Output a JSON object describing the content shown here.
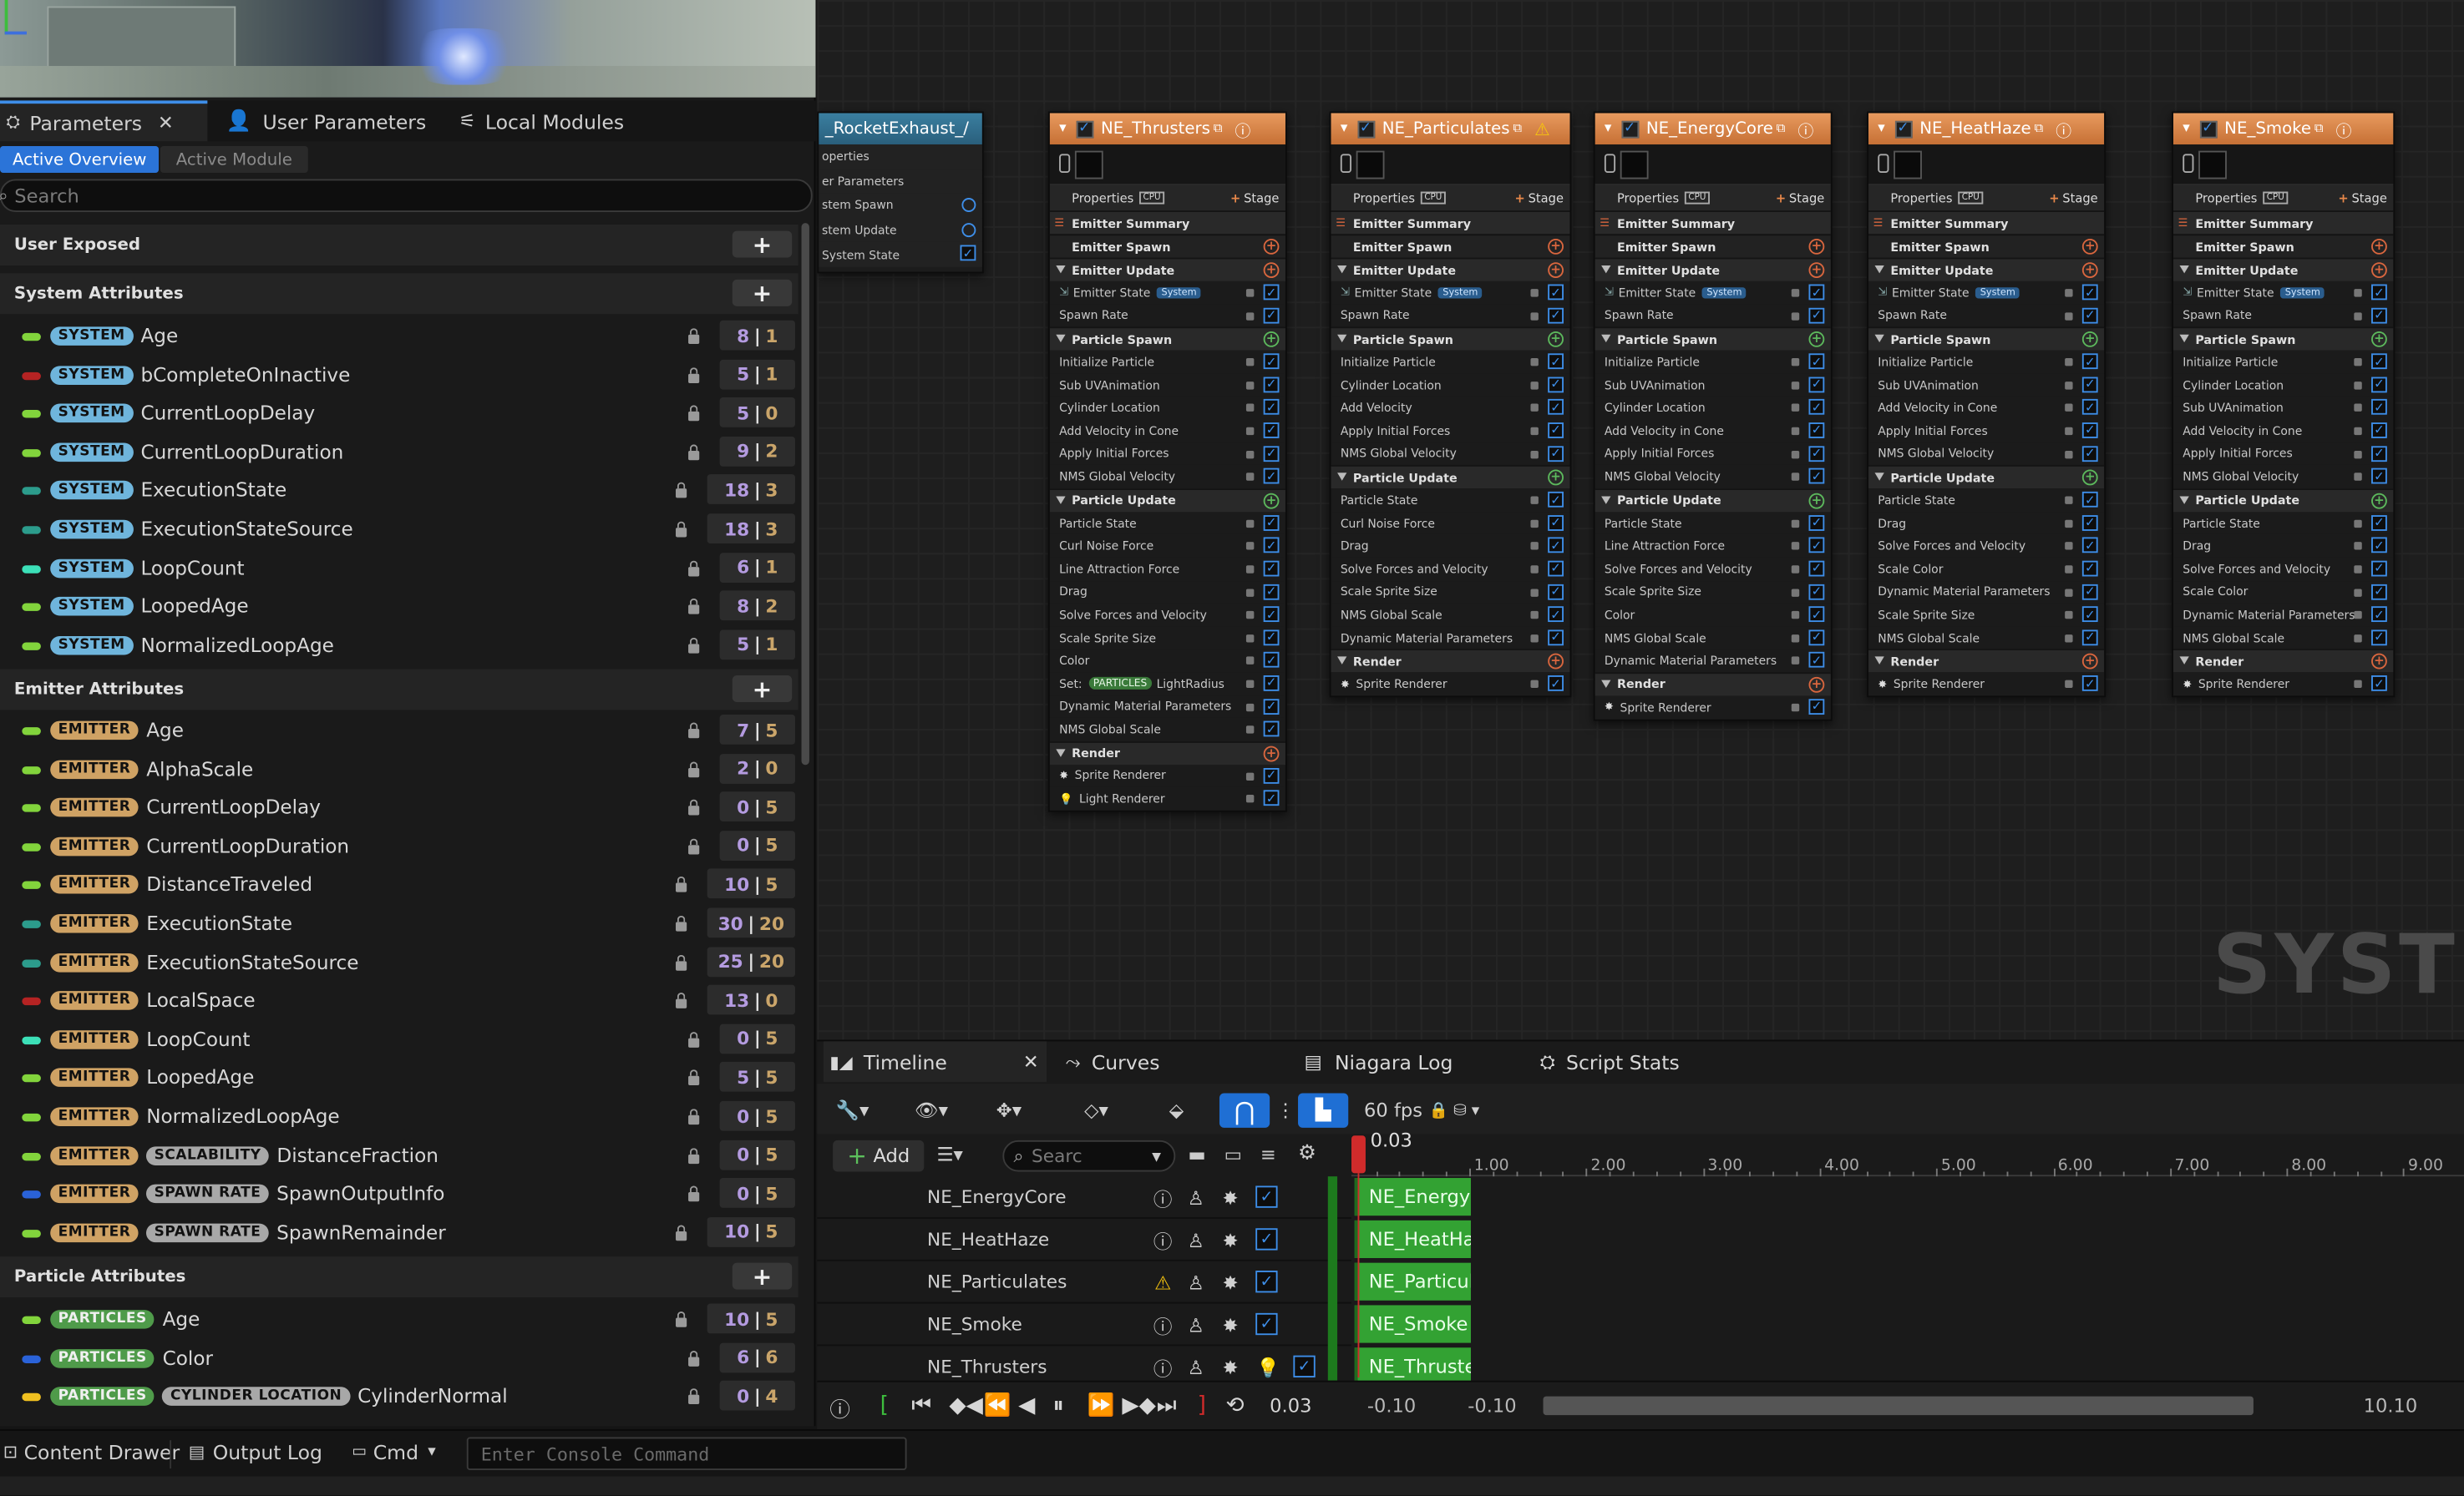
{
  "left_tabs": [
    {
      "label": "Parameters",
      "active": true
    },
    {
      "label": "User Parameters"
    },
    {
      "label": "Local Modules"
    }
  ],
  "sub_tabs": {
    "active": "Active Overview",
    "inactive": "Active Module"
  },
  "search_placeholder": "Search",
  "sections": {
    "user": "User Exposed",
    "system": "System Attributes",
    "emitter": "Emitter Attributes",
    "particle": "Particle Attributes"
  },
  "system_attrs": [
    {
      "badge": "SYSTEM",
      "name": "Age",
      "a": "8",
      "b": "1",
      "color": "#82d43c"
    },
    {
      "badge": "SYSTEM",
      "name": "bCompleteOnInactive",
      "a": "5",
      "b": "1",
      "color": "#b52323"
    },
    {
      "badge": "SYSTEM",
      "name": "CurrentLoopDelay",
      "a": "5",
      "b": "0",
      "color": "#82d43c"
    },
    {
      "badge": "SYSTEM",
      "name": "CurrentLoopDuration",
      "a": "9",
      "b": "2",
      "color": "#82d43c"
    },
    {
      "badge": "SYSTEM",
      "name": "ExecutionState",
      "a": "18",
      "b": "3",
      "color": "#2c9c8c"
    },
    {
      "badge": "SYSTEM",
      "name": "ExecutionStateSource",
      "a": "18",
      "b": "3",
      "color": "#2c9c8c"
    },
    {
      "badge": "SYSTEM",
      "name": "LoopCount",
      "a": "6",
      "b": "1",
      "color": "#3ce0b8"
    },
    {
      "badge": "SYSTEM",
      "name": "LoopedAge",
      "a": "8",
      "b": "2",
      "color": "#82d43c"
    },
    {
      "badge": "SYSTEM",
      "name": "NormalizedLoopAge",
      "a": "5",
      "b": "1",
      "color": "#82d43c"
    }
  ],
  "emitter_attrs": [
    {
      "badges": [
        "EMITTER"
      ],
      "name": "Age",
      "a": "7",
      "b": "5",
      "color": "#82d43c"
    },
    {
      "badges": [
        "EMITTER"
      ],
      "name": "AlphaScale",
      "a": "2",
      "b": "0",
      "color": "#82d43c"
    },
    {
      "badges": [
        "EMITTER"
      ],
      "name": "CurrentLoopDelay",
      "a": "0",
      "b": "5",
      "color": "#82d43c"
    },
    {
      "badges": [
        "EMITTER"
      ],
      "name": "CurrentLoopDuration",
      "a": "0",
      "b": "5",
      "color": "#82d43c"
    },
    {
      "badges": [
        "EMITTER"
      ],
      "name": "DistanceTraveled",
      "a": "10",
      "b": "5",
      "color": "#82d43c"
    },
    {
      "badges": [
        "EMITTER"
      ],
      "name": "ExecutionState",
      "a": "30",
      "b": "20",
      "color": "#2c9c8c"
    },
    {
      "badges": [
        "EMITTER"
      ],
      "name": "ExecutionStateSource",
      "a": "25",
      "b": "20",
      "color": "#2c9c8c"
    },
    {
      "badges": [
        "EMITTER"
      ],
      "name": "LocalSpace",
      "a": "13",
      "b": "0",
      "color": "#b52323"
    },
    {
      "badges": [
        "EMITTER"
      ],
      "name": "LoopCount",
      "a": "0",
      "b": "5",
      "color": "#3ce0b8"
    },
    {
      "badges": [
        "EMITTER"
      ],
      "name": "LoopedAge",
      "a": "5",
      "b": "5",
      "color": "#82d43c"
    },
    {
      "badges": [
        "EMITTER"
      ],
      "name": "NormalizedLoopAge",
      "a": "0",
      "b": "5",
      "color": "#82d43c"
    },
    {
      "badges": [
        "EMITTER",
        "SCALABILITY"
      ],
      "name": "DistanceFraction",
      "a": "0",
      "b": "5",
      "color": "#82d43c"
    },
    {
      "badges": [
        "EMITTER",
        "SPAWN RATE"
      ],
      "name": "SpawnOutputInfo",
      "a": "0",
      "b": "5",
      "color": "#2a62d8"
    },
    {
      "badges": [
        "EMITTER",
        "SPAWN RATE"
      ],
      "name": "SpawnRemainder",
      "a": "10",
      "b": "5",
      "color": "#82d43c"
    }
  ],
  "particle_attrs": [
    {
      "badges": [
        "PARTICLES"
      ],
      "name": "Age",
      "a": "10",
      "b": "5",
      "color": "#82d43c"
    },
    {
      "badges": [
        "PARTICLES"
      ],
      "name": "Color",
      "a": "6",
      "b": "6",
      "color": "#2a62d8"
    },
    {
      "badges": [
        "PARTICLES",
        "CYLINDER LOCATION"
      ],
      "name": "CylinderNormal",
      "a": "0",
      "b": "4",
      "color": "#f0c020"
    }
  ],
  "system_node": {
    "title": "_RocketExhaust_/",
    "rows": [
      "operties",
      "er Parameters",
      "stem Spawn",
      "stem Update",
      "System State"
    ]
  },
  "emitters": [
    {
      "title": "NE_Thrusters",
      "warn": false,
      "sections": [
        {
          "t": "Emitter Summary",
          "k": "sum"
        },
        {
          "t": "Emitter Spawn",
          "k": "sec"
        },
        {
          "t": "Emitter Update",
          "k": "sec"
        },
        {
          "t": "Emitter State",
          "k": "mod",
          "chip": "System"
        },
        {
          "t": "Spawn Rate",
          "k": "mod"
        },
        {
          "t": "Particle Spawn",
          "k": "sec",
          "g": true
        },
        {
          "t": "Initialize Particle",
          "k": "mod"
        },
        {
          "t": "Sub UVAnimation",
          "k": "mod"
        },
        {
          "t": "Cylinder Location",
          "k": "mod"
        },
        {
          "t": "Add Velocity in Cone",
          "k": "mod"
        },
        {
          "t": "Apply Initial Forces",
          "k": "mod"
        },
        {
          "t": "NMS Global Velocity",
          "k": "mod"
        },
        {
          "t": "Particle Update",
          "k": "sec",
          "g": true
        },
        {
          "t": "Particle State",
          "k": "mod"
        },
        {
          "t": "Curl Noise Force",
          "k": "mod"
        },
        {
          "t": "Line Attraction Force",
          "k": "mod"
        },
        {
          "t": "Drag",
          "k": "mod"
        },
        {
          "t": "Solve Forces and Velocity",
          "k": "mod"
        },
        {
          "t": "Scale Sprite Size",
          "k": "mod"
        },
        {
          "t": "Color",
          "k": "mod"
        },
        {
          "t": "Set:",
          "k": "mod",
          "pchip": "PARTICLES",
          "after": "LightRadius"
        },
        {
          "t": "Dynamic Material Parameters",
          "k": "mod"
        },
        {
          "t": "NMS Global Scale",
          "k": "mod"
        },
        {
          "t": "Render",
          "k": "sec"
        },
        {
          "t": "Sprite Renderer",
          "k": "mod"
        },
        {
          "t": "Light Renderer",
          "k": "mod"
        }
      ]
    },
    {
      "title": "NE_Particulates",
      "warn": true,
      "sections": [
        {
          "t": "Emitter Summary",
          "k": "sum"
        },
        {
          "t": "Emitter Spawn",
          "k": "sec"
        },
        {
          "t": "Emitter Update",
          "k": "sec"
        },
        {
          "t": "Emitter State",
          "k": "mod",
          "chip": "System"
        },
        {
          "t": "Spawn Rate",
          "k": "mod"
        },
        {
          "t": "Particle Spawn",
          "k": "sec",
          "g": true
        },
        {
          "t": "Initialize Particle",
          "k": "mod"
        },
        {
          "t": "Cylinder Location",
          "k": "mod"
        },
        {
          "t": "Add Velocity",
          "k": "mod"
        },
        {
          "t": "Apply Initial Forces",
          "k": "mod"
        },
        {
          "t": "NMS Global Velocity",
          "k": "mod"
        },
        {
          "t": "Particle Update",
          "k": "sec",
          "g": true
        },
        {
          "t": "Particle State",
          "k": "mod"
        },
        {
          "t": "Curl Noise Force",
          "k": "mod"
        },
        {
          "t": "Drag",
          "k": "mod"
        },
        {
          "t": "Solve Forces and Velocity",
          "k": "mod"
        },
        {
          "t": "Scale Sprite Size",
          "k": "mod"
        },
        {
          "t": "NMS Global Scale",
          "k": "mod"
        },
        {
          "t": "Dynamic Material Parameters",
          "k": "mod"
        },
        {
          "t": "Render",
          "k": "sec"
        },
        {
          "t": "Sprite Renderer",
          "k": "mod"
        }
      ]
    },
    {
      "title": "NE_EnergyCore",
      "warn": false,
      "sections": [
        {
          "t": "Emitter Summary",
          "k": "sum"
        },
        {
          "t": "Emitter Spawn",
          "k": "sec"
        },
        {
          "t": "Emitter Update",
          "k": "sec"
        },
        {
          "t": "Emitter State",
          "k": "mod",
          "chip": "System"
        },
        {
          "t": "Spawn Rate",
          "k": "mod"
        },
        {
          "t": "Particle Spawn",
          "k": "sec",
          "g": true
        },
        {
          "t": "Initialize Particle",
          "k": "mod"
        },
        {
          "t": "Sub UVAnimation",
          "k": "mod"
        },
        {
          "t": "Cylinder Location",
          "k": "mod"
        },
        {
          "t": "Add Velocity in Cone",
          "k": "mod"
        },
        {
          "t": "Apply Initial Forces",
          "k": "mod"
        },
        {
          "t": "NMS Global Velocity",
          "k": "mod"
        },
        {
          "t": "Particle Update",
          "k": "sec",
          "g": true
        },
        {
          "t": "Particle State",
          "k": "mod"
        },
        {
          "t": "Line Attraction Force",
          "k": "mod"
        },
        {
          "t": "Solve Forces and Velocity",
          "k": "mod"
        },
        {
          "t": "Scale Sprite Size",
          "k": "mod"
        },
        {
          "t": "Color",
          "k": "mod"
        },
        {
          "t": "NMS Global Scale",
          "k": "mod"
        },
        {
          "t": "Dynamic Material Parameters",
          "k": "mod"
        },
        {
          "t": "Render",
          "k": "sec"
        },
        {
          "t": "Sprite Renderer",
          "k": "mod"
        }
      ]
    },
    {
      "title": "NE_HeatHaze",
      "warn": false,
      "sections": [
        {
          "t": "Emitter Summary",
          "k": "sum"
        },
        {
          "t": "Emitter Spawn",
          "k": "sec"
        },
        {
          "t": "Emitter Update",
          "k": "sec"
        },
        {
          "t": "Emitter State",
          "k": "mod",
          "chip": "System"
        },
        {
          "t": "Spawn Rate",
          "k": "mod"
        },
        {
          "t": "Particle Spawn",
          "k": "sec",
          "g": true
        },
        {
          "t": "Initialize Particle",
          "k": "mod"
        },
        {
          "t": "Sub UVAnimation",
          "k": "mod"
        },
        {
          "t": "Add Velocity in Cone",
          "k": "mod"
        },
        {
          "t": "Apply Initial Forces",
          "k": "mod"
        },
        {
          "t": "NMS Global Velocity",
          "k": "mod"
        },
        {
          "t": "Particle Update",
          "k": "sec",
          "g": true
        },
        {
          "t": "Particle State",
          "k": "mod"
        },
        {
          "t": "Drag",
          "k": "mod"
        },
        {
          "t": "Solve Forces and Velocity",
          "k": "mod"
        },
        {
          "t": "Scale Color",
          "k": "mod"
        },
        {
          "t": "Dynamic Material Parameters",
          "k": "mod"
        },
        {
          "t": "Scale Sprite Size",
          "k": "mod"
        },
        {
          "t": "NMS Global Scale",
          "k": "mod"
        },
        {
          "t": "Render",
          "k": "sec"
        },
        {
          "t": "Sprite Renderer",
          "k": "mod"
        }
      ]
    },
    {
      "title": "NE_Smoke",
      "warn": false,
      "sections": [
        {
          "t": "Emitter Summary",
          "k": "sum"
        },
        {
          "t": "Emitter Spawn",
          "k": "sec"
        },
        {
          "t": "Emitter Update",
          "k": "sec"
        },
        {
          "t": "Emitter State",
          "k": "mod",
          "chip": "System"
        },
        {
          "t": "Spawn Rate",
          "k": "mod"
        },
        {
          "t": "Particle Spawn",
          "k": "sec",
          "g": true
        },
        {
          "t": "Initialize Particle",
          "k": "mod"
        },
        {
          "t": "Cylinder Location",
          "k": "mod"
        },
        {
          "t": "Sub UVAnimation",
          "k": "mod"
        },
        {
          "t": "Add Velocity in Cone",
          "k": "mod"
        },
        {
          "t": "Apply Initial Forces",
          "k": "mod"
        },
        {
          "t": "NMS Global Velocity",
          "k": "mod"
        },
        {
          "t": "Particle Update",
          "k": "sec",
          "g": true
        },
        {
          "t": "Particle State",
          "k": "mod"
        },
        {
          "t": "Drag",
          "k": "mod"
        },
        {
          "t": "Solve Forces and Velocity",
          "k": "mod"
        },
        {
          "t": "Scale Color",
          "k": "mod"
        },
        {
          "t": "Dynamic Material Parameters",
          "k": "mod"
        },
        {
          "t": "NMS Global Scale",
          "k": "mod"
        },
        {
          "t": "Render",
          "k": "sec"
        },
        {
          "t": "Sprite Renderer",
          "k": "mod"
        }
      ]
    }
  ],
  "node_labels": {
    "properties": "Properties",
    "stage": "Stage",
    "cpu": "CPU"
  },
  "watermark": "SYSTEM",
  "timeline": {
    "tabs": [
      "Timeline",
      "Curves",
      "Niagara Log",
      "Script Stats"
    ],
    "fps": "60 fps",
    "add": "Add",
    "search_placeholder": "Searc",
    "playhead": "0.03",
    "ticks": [
      "1.00",
      "2.00",
      "3.00",
      "4.00",
      "5.00",
      "6.00",
      "7.00",
      "8.00",
      "9.00"
    ],
    "tracks": [
      "NE_EnergyCore",
      "NE_HeatHaze",
      "NE_Particulates",
      "NE_Smoke",
      "NE_Thrusters"
    ],
    "bars": [
      "NE_EnergyC",
      "NE_HeatHa",
      "NE_Particul",
      "NE_Smoke",
      "NE_Thruste"
    ],
    "time": "0.03",
    "range_start": "-0.10",
    "range_start2": "-0.10",
    "range_end": "10.10"
  },
  "bottom": {
    "content_drawer": "Content Drawer",
    "output_log": "Output Log",
    "cmd": "Cmd",
    "console_placeholder": "Enter Console Command"
  }
}
